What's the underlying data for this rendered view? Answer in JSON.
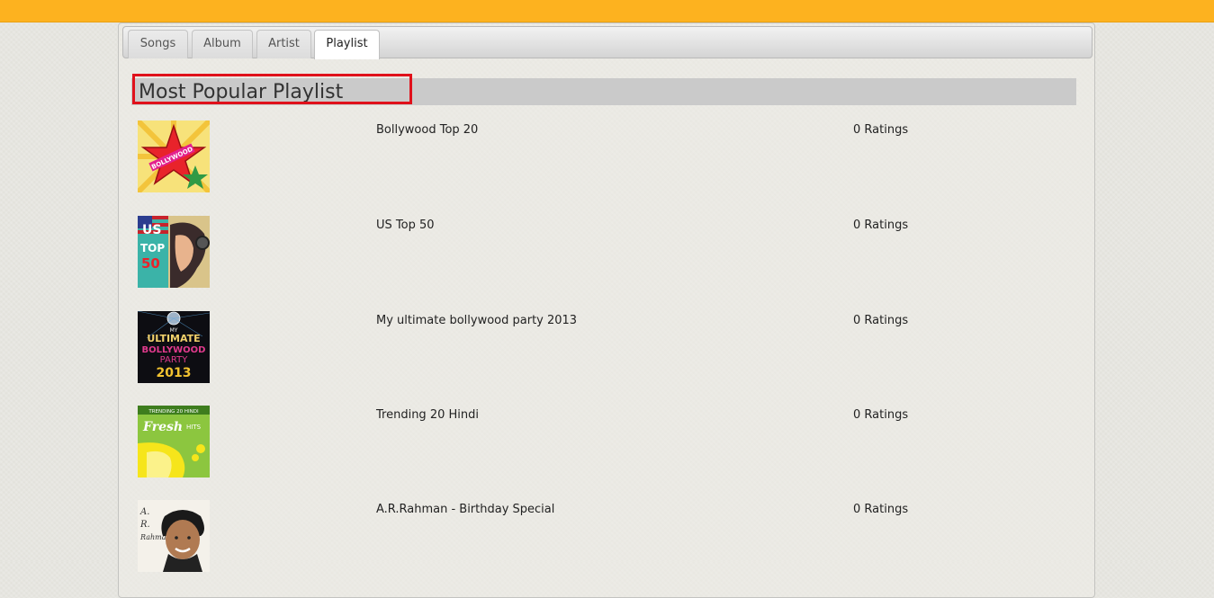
{
  "tabs": [
    {
      "label": "Songs"
    },
    {
      "label": "Album"
    },
    {
      "label": "Artist"
    },
    {
      "label": "Playlist"
    }
  ],
  "active_tab": "Playlist",
  "section": {
    "title": "Most Popular Playlist"
  },
  "playlists": [
    {
      "name": "Bollywood Top 20",
      "rating": "0 Ratings",
      "cover_text": "BOLLYWOOD"
    },
    {
      "name": "US Top 50",
      "rating": "0 Ratings",
      "cover_text": [
        "US",
        "TOP",
        "50"
      ]
    },
    {
      "name": "My ultimate bollywood party 2013",
      "rating": "0 Ratings",
      "cover_text": [
        "MY",
        "ULTIMATE",
        "BOLLYWOOD",
        "PARTY",
        "2013"
      ]
    },
    {
      "name": "Trending 20 Hindi",
      "rating": "0 Ratings",
      "cover_text": [
        "TRENDING 20 HINDI",
        "Fresh",
        "HITS"
      ]
    },
    {
      "name": "A.R.Rahman - Birthday Special",
      "rating": "0 Ratings",
      "cover_text": [
        "A.",
        "R.",
        "Rahma"
      ]
    }
  ],
  "colors": {
    "topbar": "#fdb21f",
    "highlight_border": "#e0111b",
    "heading_strip": "#cacaca"
  }
}
